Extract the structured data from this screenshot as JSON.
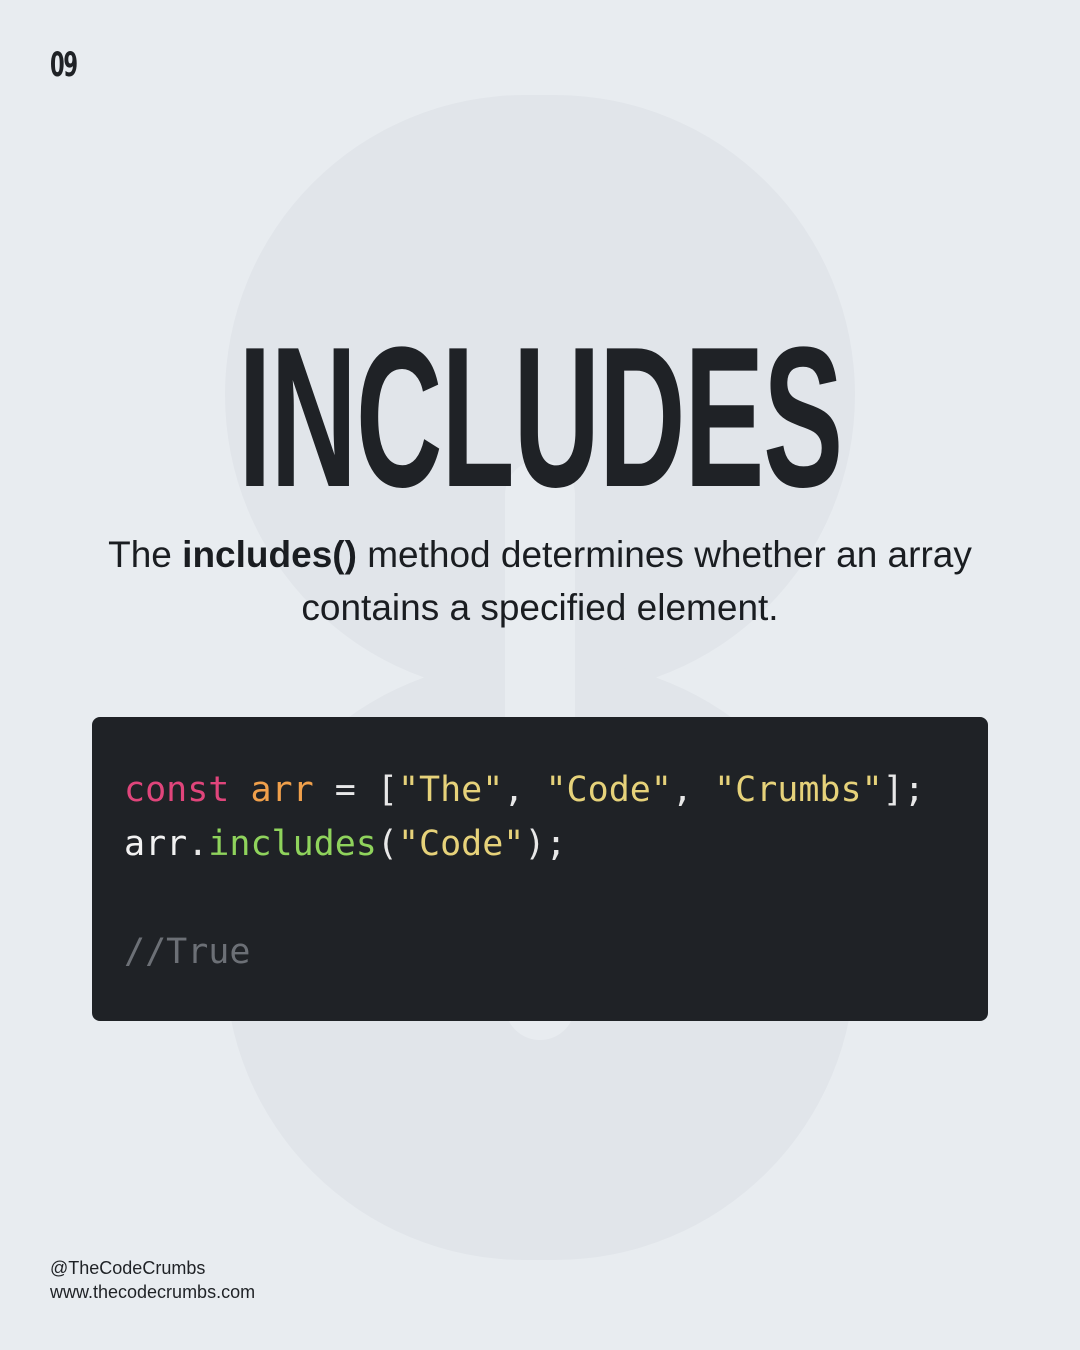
{
  "page_number": "09",
  "title": "INCLUDES",
  "description": {
    "prefix": "The ",
    "method": "includes()",
    "rest": " method determines whether an array contains a specified element."
  },
  "code": {
    "line1": {
      "keyword": "const",
      "var": "arr",
      "op": "=",
      "open": "[",
      "s1": "\"The\"",
      "comma1": ",",
      "s2": "\"Code\"",
      "comma2": ",",
      "s3": "\"Crumbs\"",
      "close": "];"
    },
    "line2": {
      "ident": "arr",
      "dot": ".",
      "method": "includes",
      "open": "(",
      "arg": "\"Code\"",
      "close": ");"
    },
    "comment": "//True"
  },
  "footer": {
    "handle": "@TheCodeCrumbs",
    "website": "www.thecodecrumbs.com"
  },
  "colors": {
    "background": "#e8ecf0",
    "code_background": "#1f2226",
    "keyword": "#e0457b",
    "variable": "#f0a04b",
    "string": "#e6d27a",
    "method": "#8fd35c",
    "comment": "#6c7076"
  }
}
